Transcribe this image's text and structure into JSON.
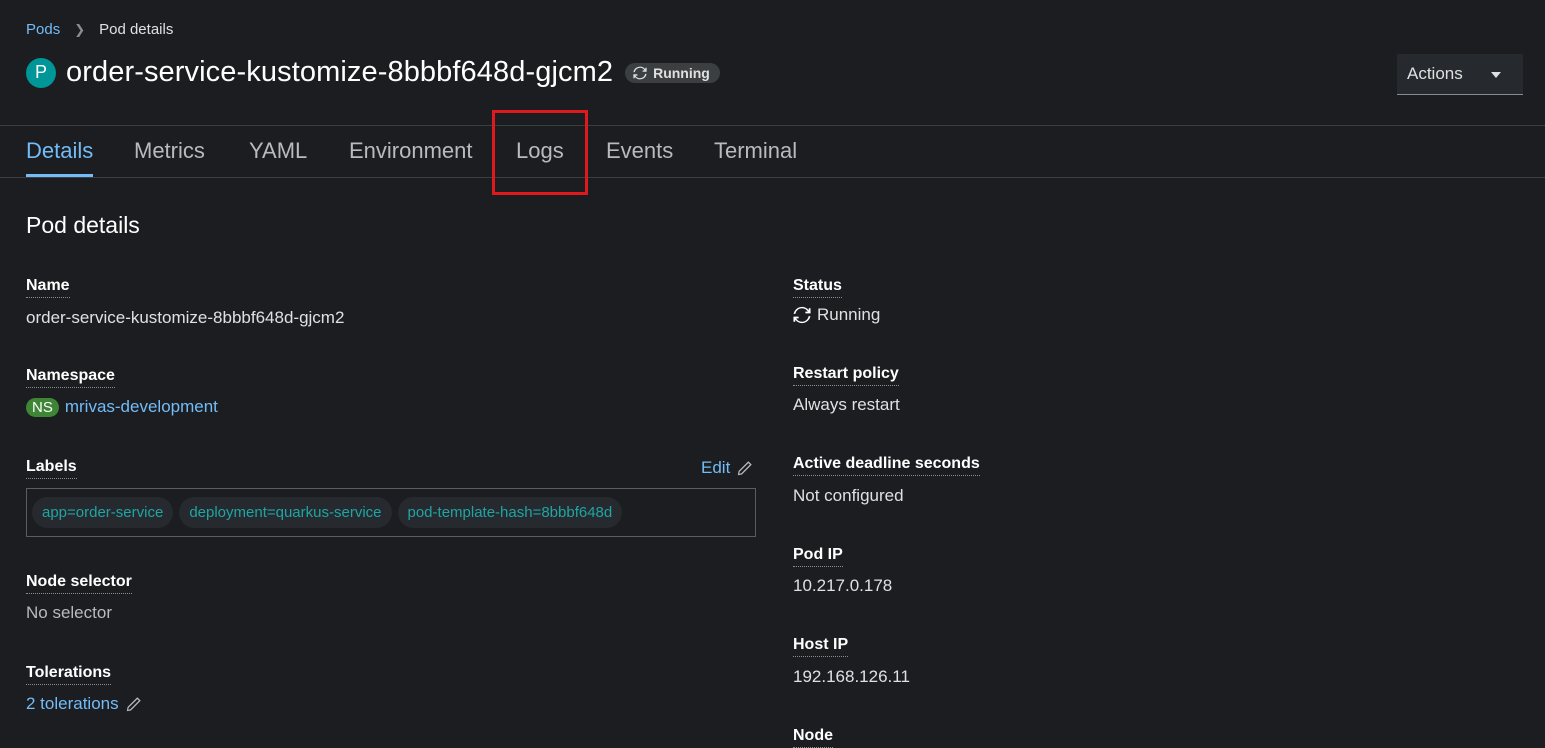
{
  "breadcrumb": {
    "parent": "Pods",
    "current": "Pod details"
  },
  "header": {
    "badge": "P",
    "title": "order-service-kustomize-8bbbf648d-gjcm2",
    "status": "Running",
    "actions_label": "Actions"
  },
  "tabs": [
    "Details",
    "Metrics",
    "YAML",
    "Environment",
    "Logs",
    "Events",
    "Terminal"
  ],
  "active_tab": "Details",
  "section_title": "Pod details",
  "left": {
    "name_label": "Name",
    "name_value": "order-service-kustomize-8bbbf648d-gjcm2",
    "namespace_label": "Namespace",
    "namespace_badge": "NS",
    "namespace_value": "mrivas-development",
    "labels_label": "Labels",
    "labels_edit": "Edit",
    "labels": [
      "app=order-service",
      "deployment=quarkus-service",
      "pod-template-hash=8bbbf648d"
    ],
    "node_selector_label": "Node selector",
    "node_selector_value": "No selector",
    "tolerations_label": "Tolerations",
    "tolerations_value": "2 tolerations"
  },
  "right": {
    "status_label": "Status",
    "status_value": "Running",
    "restart_policy_label": "Restart policy",
    "restart_policy_value": "Always restart",
    "active_deadline_label": "Active deadline seconds",
    "active_deadline_value": "Not configured",
    "pod_ip_label": "Pod IP",
    "pod_ip_value": "10.217.0.178",
    "host_ip_label": "Host IP",
    "host_ip_value": "192.168.126.11",
    "node_label": "Node"
  },
  "colors": {
    "background": "#1b1d21",
    "link": "#73bcf7",
    "pod_badge": "#009596",
    "ns_badge": "#3e8635",
    "label_chip_text": "#1fa5a5",
    "highlight": "#e0191e"
  },
  "icons": [
    "sync-icon",
    "caret-down-icon",
    "pencil-icon",
    "chevron-right-icon"
  ]
}
